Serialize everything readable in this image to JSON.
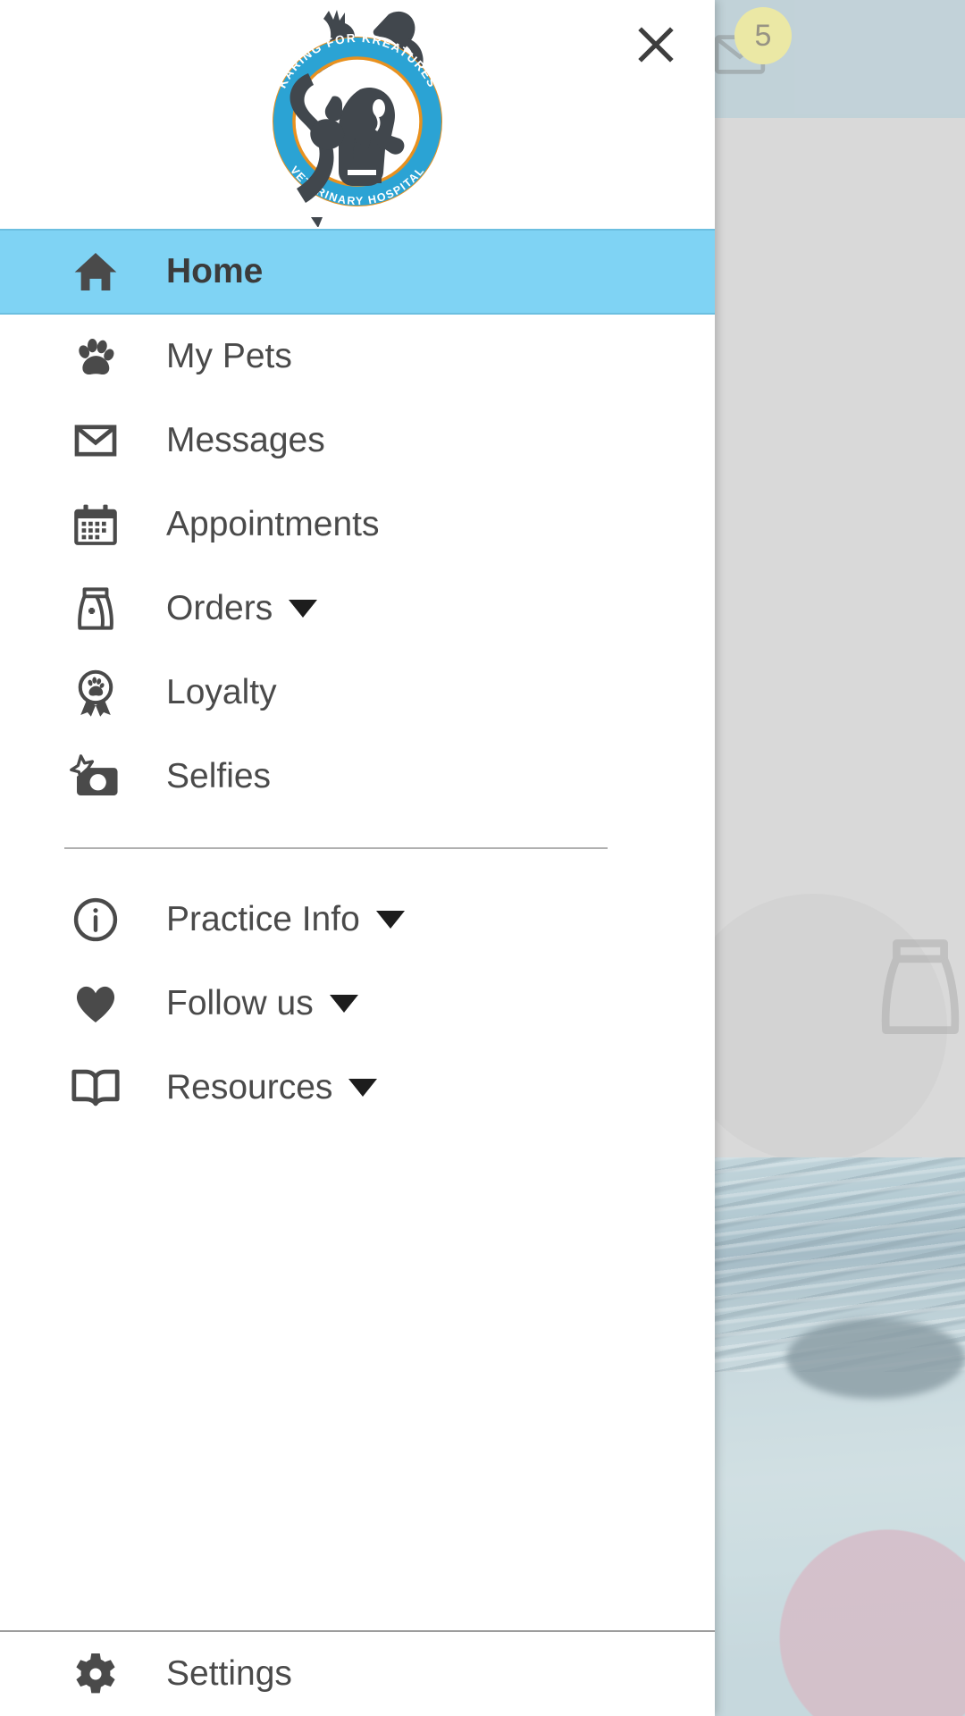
{
  "app_background": {
    "header_color": "#a7bfc8",
    "body_color": "#c9c9c9",
    "mail_icon": "envelope-icon",
    "badge_count": "5",
    "badge_color": "#e3de7e",
    "faded_icon": "food-bag-icon"
  },
  "drawer": {
    "close_icon": "close-icon",
    "logo": {
      "name": "karing-for-kreatures-veterinary-hospital-logo",
      "top_text": "KARING FOR KREATURES",
      "bottom_text": "VETERINARY HOSPITAL",
      "ring_color": "#2ba3d4",
      "outline_color": "#e8911f",
      "silhouette_color": "#41474d"
    },
    "selected_color": "#7fd3f4",
    "primary_items": [
      {
        "label": "Home",
        "icon": "home-icon",
        "selected": true,
        "expandable": false
      },
      {
        "label": "My Pets",
        "icon": "paw-icon",
        "selected": false,
        "expandable": false
      },
      {
        "label": "Messages",
        "icon": "envelope-icon",
        "selected": false,
        "expandable": false
      },
      {
        "label": "Appointments",
        "icon": "calendar-icon",
        "selected": false,
        "expandable": false
      },
      {
        "label": "Orders",
        "icon": "food-bag-icon",
        "selected": false,
        "expandable": true
      },
      {
        "label": "Loyalty",
        "icon": "award-paw-icon",
        "selected": false,
        "expandable": false
      },
      {
        "label": "Selfies",
        "icon": "camera-star-icon",
        "selected": false,
        "expandable": false
      }
    ],
    "secondary_items": [
      {
        "label": "Practice Info",
        "icon": "info-circle-icon",
        "expandable": true
      },
      {
        "label": "Follow us",
        "icon": "heart-icon",
        "expandable": true
      },
      {
        "label": "Resources",
        "icon": "book-icon",
        "expandable": true
      }
    ],
    "footer_items": [
      {
        "label": "Settings",
        "icon": "gear-icon",
        "expandable": false
      }
    ]
  }
}
